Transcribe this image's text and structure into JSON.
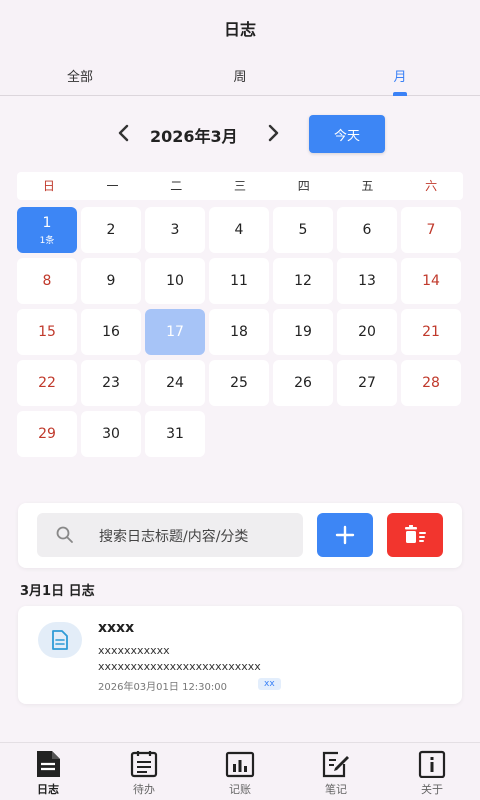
{
  "header": {
    "title": "日志"
  },
  "tabs": [
    {
      "label": "全部",
      "active": false
    },
    {
      "label": "周",
      "active": false
    },
    {
      "label": "月",
      "active": true
    }
  ],
  "calendar": {
    "month_label": "2026年3月",
    "today_label": "今天",
    "weekdays": [
      "日",
      "一",
      "二",
      "三",
      "四",
      "五",
      "六"
    ],
    "leading_blanks": 0,
    "days": [
      "1",
      "2",
      "3",
      "4",
      "5",
      "6",
      "7",
      "8",
      "9",
      "10",
      "11",
      "12",
      "13",
      "14",
      "15",
      "16",
      "17",
      "18",
      "19",
      "20",
      "21",
      "22",
      "23",
      "24",
      "25",
      "26",
      "27",
      "28",
      "29",
      "30",
      "31"
    ],
    "selected_day": "1",
    "selected_sub": "1条",
    "today_day": "17"
  },
  "search": {
    "placeholder": "搜索日志标题/内容/分类"
  },
  "list": {
    "date_heading": "3月1日 日志",
    "entries": [
      {
        "title": "xxxx",
        "line1": "xxxxxxxxxxx",
        "line2": "xxxxxxxxxxxxxxxxxxxxxxxxx",
        "timestamp": "2026年03月01日 12:30:00",
        "tag": "xx",
        "icon": "document-icon"
      }
    ]
  },
  "bottom_nav": [
    {
      "label": "日志",
      "icon": "journal-icon",
      "active": true
    },
    {
      "label": "待办",
      "icon": "todo-icon",
      "active": false
    },
    {
      "label": "记账",
      "icon": "ledger-icon",
      "active": false
    },
    {
      "label": "笔记",
      "icon": "note-icon",
      "active": false
    },
    {
      "label": "关于",
      "icon": "info-icon",
      "active": false
    }
  ],
  "colors": {
    "accent": "#3d86f5",
    "danger": "#f2352e",
    "weekend": "#c0392b",
    "today_highlight": "#a7c4f7"
  }
}
